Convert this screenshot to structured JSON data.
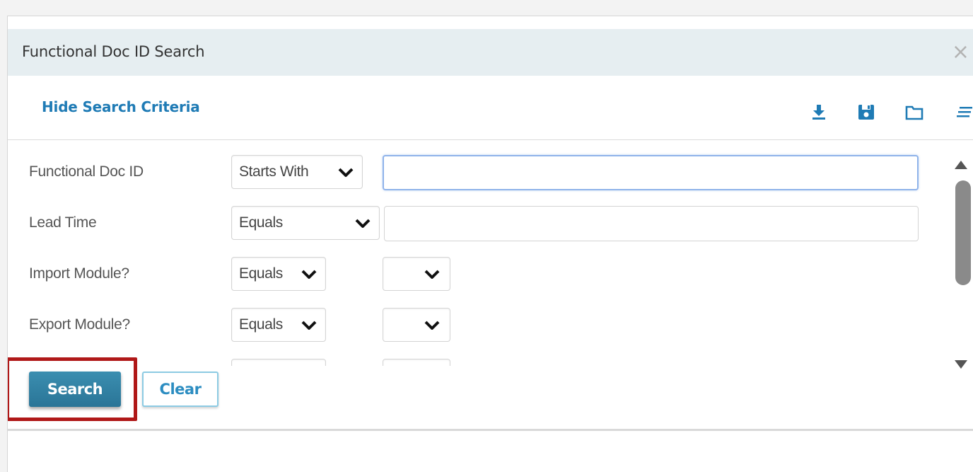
{
  "dialog": {
    "title": "Functional Doc ID Search",
    "close_glyph": "×"
  },
  "toolbar": {
    "hide_label": "Hide Search Criteria",
    "icons": [
      "download-icon",
      "save-icon",
      "folder-icon",
      "list-icon"
    ],
    "accent": "#1f7bb5"
  },
  "criteria": {
    "rows": [
      {
        "label": "Functional Doc ID",
        "operator": "Starts With",
        "value": ""
      },
      {
        "label": "Lead Time",
        "operator": "Equals",
        "value": ""
      },
      {
        "label": "Import Module?",
        "operator": "Equals",
        "value": ""
      },
      {
        "label": "Export Module?",
        "operator": "Equals",
        "value": ""
      }
    ]
  },
  "buttons": {
    "search_label": "Search",
    "clear_label": "Clear"
  },
  "colors": {
    "search_button": "#2a7597",
    "highlight": "#b01818"
  }
}
